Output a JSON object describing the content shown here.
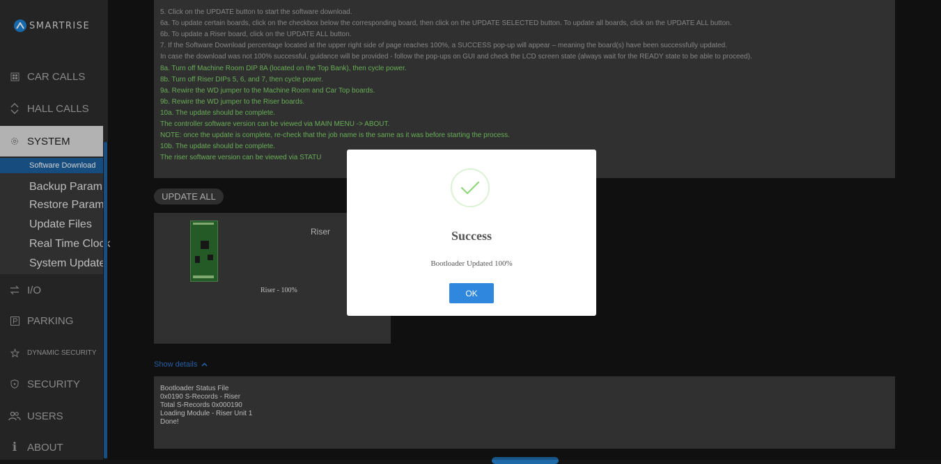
{
  "brand": {
    "logo_text": "SMARTRISE"
  },
  "sidebar": {
    "items": [
      {
        "label": "CAR CALLS",
        "icon": "car-calls-icon"
      },
      {
        "label": "HALL CALLS",
        "icon": "chevrons-icon"
      },
      {
        "label": "SYSTEM",
        "icon": "gear-icon"
      },
      {
        "label": "I/O",
        "icon": "io-arrows-icon"
      },
      {
        "label": "PARKING",
        "icon": "parking-icon"
      },
      {
        "label": "DYNAMIC SECURITY",
        "icon": "star-icon"
      },
      {
        "label": "SECURITY",
        "icon": "shield-icon"
      },
      {
        "label": "USERS",
        "icon": "users-icon"
      },
      {
        "label": "ABOUT",
        "icon": "info-icon"
      }
    ],
    "system_submenu": [
      {
        "label": "Software Download"
      },
      {
        "label": "Backup Param"
      },
      {
        "label": "Restore Param"
      },
      {
        "label": "Update Files"
      },
      {
        "label": "Real Time Clock"
      },
      {
        "label": "System Update"
      }
    ]
  },
  "instructions": {
    "lines_gray": [
      "5. Click on the UPDATE button to start the software download.",
      "6a. To update certain boards, click on the checkbox below the corresponding board, then click on the UPDATE SELECTED button. To update all boards, click on the UPDATE ALL button.",
      "6b. To update a Riser board, click on the UPDATE ALL button.",
      "7. If the Software Download percentage located at the upper right side of page reaches 100%, a SUCCESS pop-up will appear – meaning the board(s) have been successfully updated.",
      "In case the download was not 100% successful, guidance will be provided - follow the pop-ups on GUI and check the LCD screen state (always wait for the READY state to be able to proceed)."
    ],
    "lines_green": [
      "8a. Turn off Machine Room DIP 8A (located on the Top Bank), then cycle power.",
      "8b. Turn off Riser DIPs 5, 6, and 7, then cycle power.",
      "9a. Rewire the WD jumper to the Machine Room and Car Top boards.",
      "9b. Rewire the WD jumper to the Riser boards.",
      "10a. The update should be complete.",
      "The controller software version can be viewed via MAIN MENU -> ABOUT.",
      "NOTE: once the update is complete, re-check that the job name is the same as it was before starting the process.",
      "10b. The update should be complete.",
      "The riser software version can be viewed via STATU"
    ]
  },
  "update_all_label": "UPDATE ALL",
  "board": {
    "title": "Riser",
    "status": "Riser - 100%",
    "progress_percent": 100
  },
  "show_details_label": "Show details",
  "log": {
    "lines": [
      "Bootloader Status File",
      "0x0190 S-Records - Riser",
      "Total S-Records 0x000190",
      "Loading Module - Riser Unit 1",
      "Done!"
    ]
  },
  "modal": {
    "title": "Success",
    "message": "Bootloader Updated 100%",
    "ok_label": "OK",
    "check_color": "#8fd67a"
  }
}
